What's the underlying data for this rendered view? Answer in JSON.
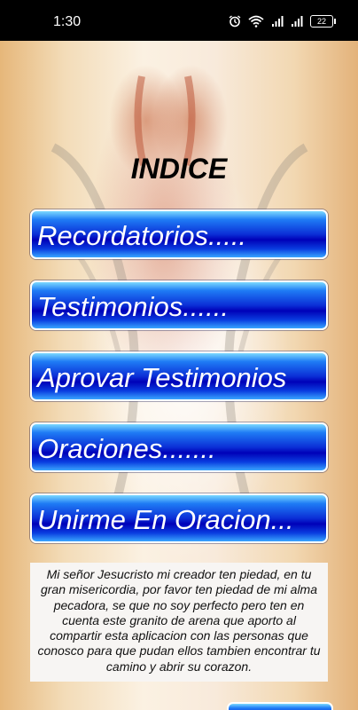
{
  "status_bar": {
    "time": "1:30",
    "battery": "22",
    "icons": [
      "alarm-icon",
      "wifi-icon",
      "signal-icon",
      "signal-icon",
      "battery-icon"
    ]
  },
  "page": {
    "title": "INDICE"
  },
  "menu": {
    "items": [
      {
        "label": "Recordatorios....."
      },
      {
        "label": "Testimonios......"
      },
      {
        "label": "Aprovar Testimonios"
      },
      {
        "label": "Oraciones......."
      },
      {
        "label": "Unirme En Oracion..."
      }
    ]
  },
  "prayer": {
    "text": "Mi señor Jesucristo mi creador ten piedad, en tu gran misericordia, por favor ten piedad de mi alma pecadora, se que no soy perfecto pero ten en cuenta este granito de arena que aporto al compartir esta aplicacion con las personas que conosco para que pudan ellos tambien encontrar tu camino y abrir su corazon."
  },
  "colors": {
    "button_top": "#7bd8ff",
    "button_mid": "#0000b8",
    "button_border": "#ffffff",
    "title_color": "#000000"
  }
}
